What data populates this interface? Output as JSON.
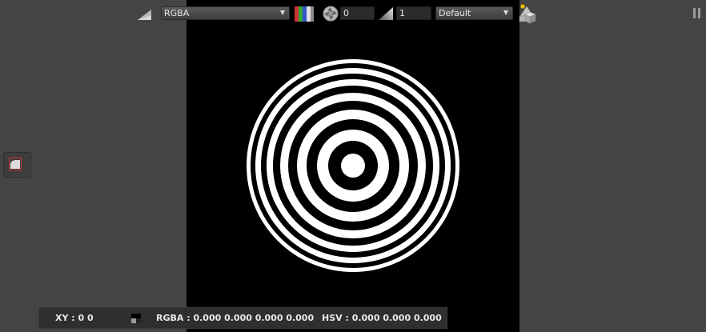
{
  "toolbar": {
    "channel_select": {
      "value": "RGBA"
    },
    "exposure_value": "0",
    "gamma_value": "1",
    "lut_select": {
      "value": "Default"
    },
    "icons": [
      "gain-triangle-icon",
      "rgb-channels-icon",
      "aperture-icon",
      "gamma-ramp-icon",
      "shapes-3d-icon",
      "pause-icon"
    ]
  },
  "side_toolbar": {
    "icons": [
      "crop-region-icon"
    ]
  },
  "status_bar": {
    "xy": "XY : 0 0",
    "rgba": "RGBA : 0.000 0.000 0.000 0.000",
    "hsv": "HSV : 0.000 0.000 0.000"
  },
  "colors": {
    "panel_bg": "#444444",
    "viewer_bg": "#000000",
    "status_bg": "#2f2f2f",
    "channel_red": "#cc3333",
    "channel_green": "#33aa33",
    "channel_blue": "#3355cc",
    "indicator_yellow": "#e8c400"
  }
}
